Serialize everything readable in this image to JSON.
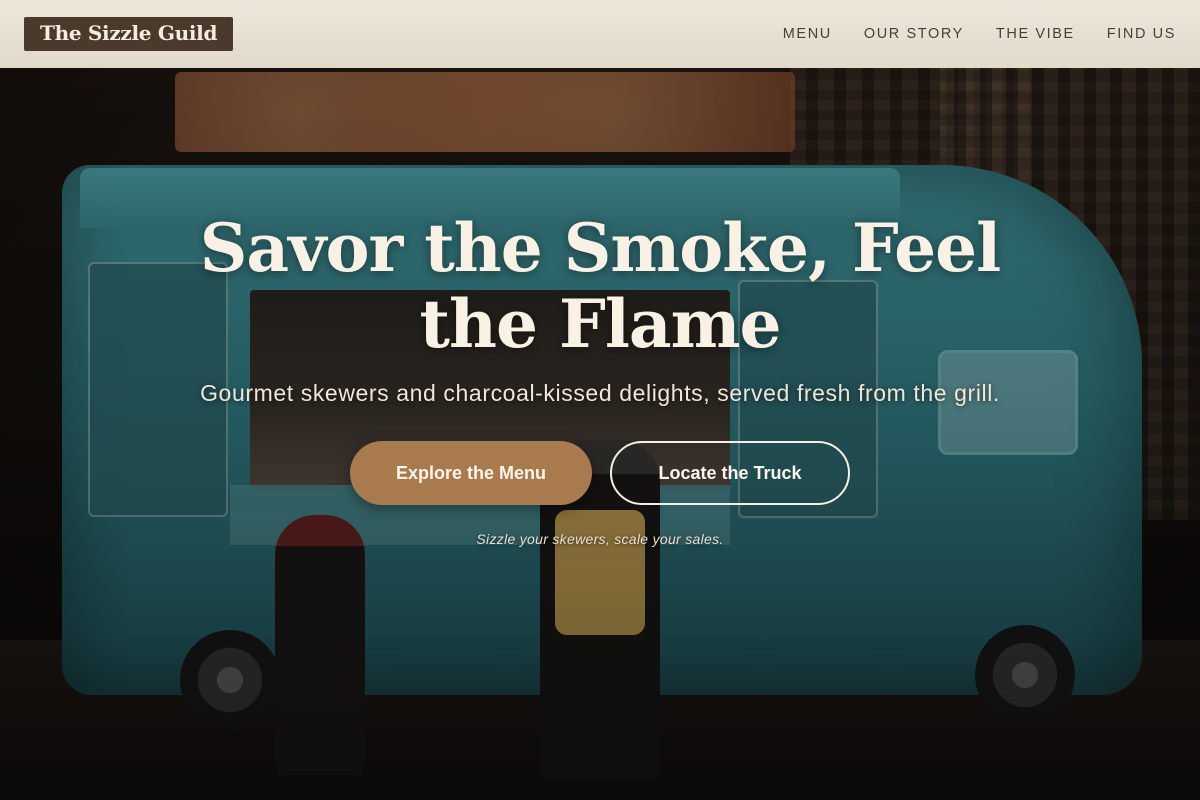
{
  "brand": {
    "logo_text": "The Sizzle Guild"
  },
  "nav": {
    "items": [
      {
        "label": "MENU"
      },
      {
        "label": "OUR STORY"
      },
      {
        "label": "THE VIBE"
      },
      {
        "label": "FIND US"
      }
    ]
  },
  "hero": {
    "headline": "Savor the Smoke, Feel the Flame",
    "subheadline": "Gourmet skewers and charcoal-kissed delights, served fresh from the grill.",
    "primary_cta": "Explore the Menu",
    "secondary_cta": "Locate the Truck",
    "tagline": "Sizzle your skewers, scale your sales."
  },
  "colors": {
    "header_bg": "#f2ebdd",
    "logo_bg": "#4a3a2c",
    "accent": "#a87a4e",
    "text_light": "#f8f1e4",
    "nav_text": "#4a3f36"
  }
}
